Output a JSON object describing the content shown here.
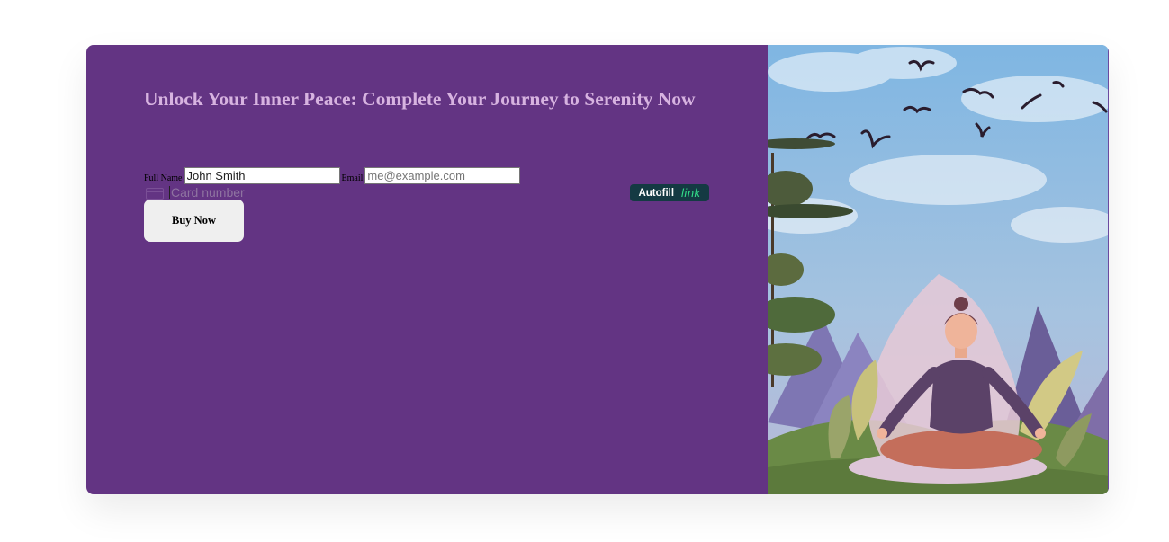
{
  "heading": "Unlock Your Inner Peace: Complete Your Journey to Serenity Now",
  "form": {
    "full_name_label": "Full Name",
    "full_name_value": "John Smith",
    "email_label": "Email",
    "email_placeholder": "me@example.com",
    "card_placeholder": "Card number",
    "card_icon": "credit-card-icon"
  },
  "autofill": {
    "label": "Autofill",
    "brand": "link"
  },
  "buy_button_label": "Buy Now",
  "illustration": {
    "subject": "meditating-woman-illustration"
  },
  "colors": {
    "panel": "#633483",
    "heading": "#d7b3e0",
    "autofill_bg": "#143a43",
    "link_green": "#33dd8a"
  }
}
